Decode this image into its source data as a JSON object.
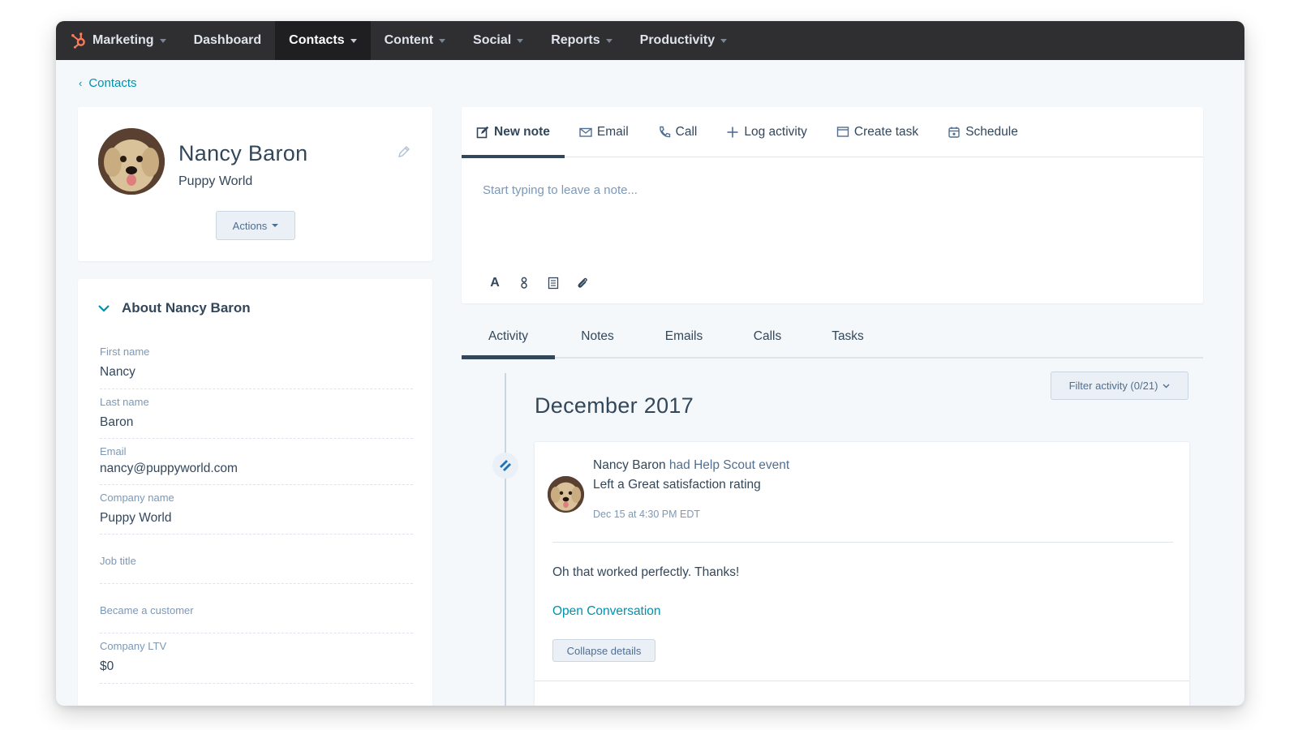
{
  "nav": {
    "items": [
      {
        "label": "Marketing",
        "has_caret": true,
        "active": false
      },
      {
        "label": "Dashboard",
        "has_caret": false,
        "active": false
      },
      {
        "label": "Contacts",
        "has_caret": true,
        "active": true
      },
      {
        "label": "Content",
        "has_caret": true,
        "active": false
      },
      {
        "label": "Social",
        "has_caret": true,
        "active": false
      },
      {
        "label": "Reports",
        "has_caret": true,
        "active": false
      },
      {
        "label": "Productivity",
        "has_caret": true,
        "active": false
      }
    ],
    "logo_icon": "hubspot-sprocket-icon",
    "logo_color": "#ff7a59"
  },
  "breadcrumb": {
    "label": "Contacts"
  },
  "profile": {
    "name": "Nancy Baron",
    "company": "Puppy World",
    "actions_label": "Actions"
  },
  "about": {
    "title": "About Nancy Baron",
    "properties": [
      {
        "label": "First name",
        "value": "Nancy"
      },
      {
        "label": "Last name",
        "value": "Baron"
      },
      {
        "label": "Email",
        "value": "nancy@puppyworld.com"
      },
      {
        "label": "Company name",
        "value": "Puppy World"
      },
      {
        "label": "Job title",
        "value": ""
      },
      {
        "label": "Became a customer",
        "value": ""
      },
      {
        "label": "Company LTV",
        "value": "$0"
      }
    ]
  },
  "composer": {
    "tabs": [
      {
        "label": "New note",
        "icon": "edit-note-icon"
      },
      {
        "label": "Email",
        "icon": "envelope-icon"
      },
      {
        "label": "Call",
        "icon": "phone-icon"
      },
      {
        "label": "Log activity",
        "icon": "plus-icon"
      },
      {
        "label": "Create task",
        "icon": "task-icon"
      },
      {
        "label": "Schedule",
        "icon": "calendar-icon"
      }
    ],
    "placeholder": "Start typing to leave a note...",
    "tools": [
      "text-format-icon",
      "personalize-icon",
      "document-icon",
      "attachment-icon"
    ]
  },
  "activity": {
    "tabs": [
      "Activity",
      "Notes",
      "Emails",
      "Calls",
      "Tasks"
    ],
    "filter_label": "Filter activity (0/21)",
    "month": "December 2017",
    "event": {
      "actor": "Nancy Baron",
      "action": "had Help Scout event",
      "detail": "Left a Great satisfaction rating",
      "time": "Dec 15 at 4:30 PM EDT",
      "body": "Oh that worked perfectly. Thanks!",
      "link": "Open Conversation",
      "collapse_label": "Collapse details"
    }
  },
  "colors": {
    "nav_bg": "#2f2f31",
    "accent_link": "#0091ae",
    "text": "#33475b",
    "muted": "#7c98b6",
    "helpscout_icon": "#1f73b7"
  }
}
